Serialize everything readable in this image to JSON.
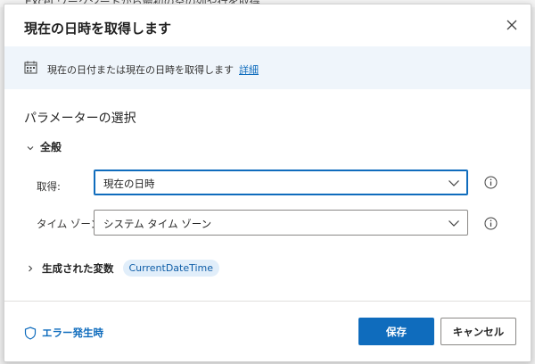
{
  "background": {
    "partial_text": "Excel ワークシートから最初の空の列や行を取得"
  },
  "dialog": {
    "title": "現在の日時を取得します",
    "info": {
      "description": "現在の日付または現在の日時を取得します",
      "link": "詳細"
    },
    "section_title": "パラメーターの選択",
    "group_label": "全般",
    "fields": [
      {
        "label": "取得:",
        "value": "現在の日時"
      },
      {
        "label": "タイム ゾーン:",
        "value": "システム タイム ゾーン"
      }
    ],
    "variables": {
      "label": "生成された変数",
      "chip": "CurrentDateTime"
    },
    "footer": {
      "error_link": "エラー発生時",
      "save": "保存",
      "cancel": "キャンセル"
    }
  },
  "colors": {
    "accent": "#0f6cbd",
    "info_bar": "#eff5fb",
    "chip_bg": "#e1eefa"
  },
  "icons": [
    "close-icon",
    "calendar-icon",
    "chevron-down-icon",
    "chevron-right-icon",
    "info-icon",
    "shield-icon",
    "dropdown-chevron-icon"
  ]
}
